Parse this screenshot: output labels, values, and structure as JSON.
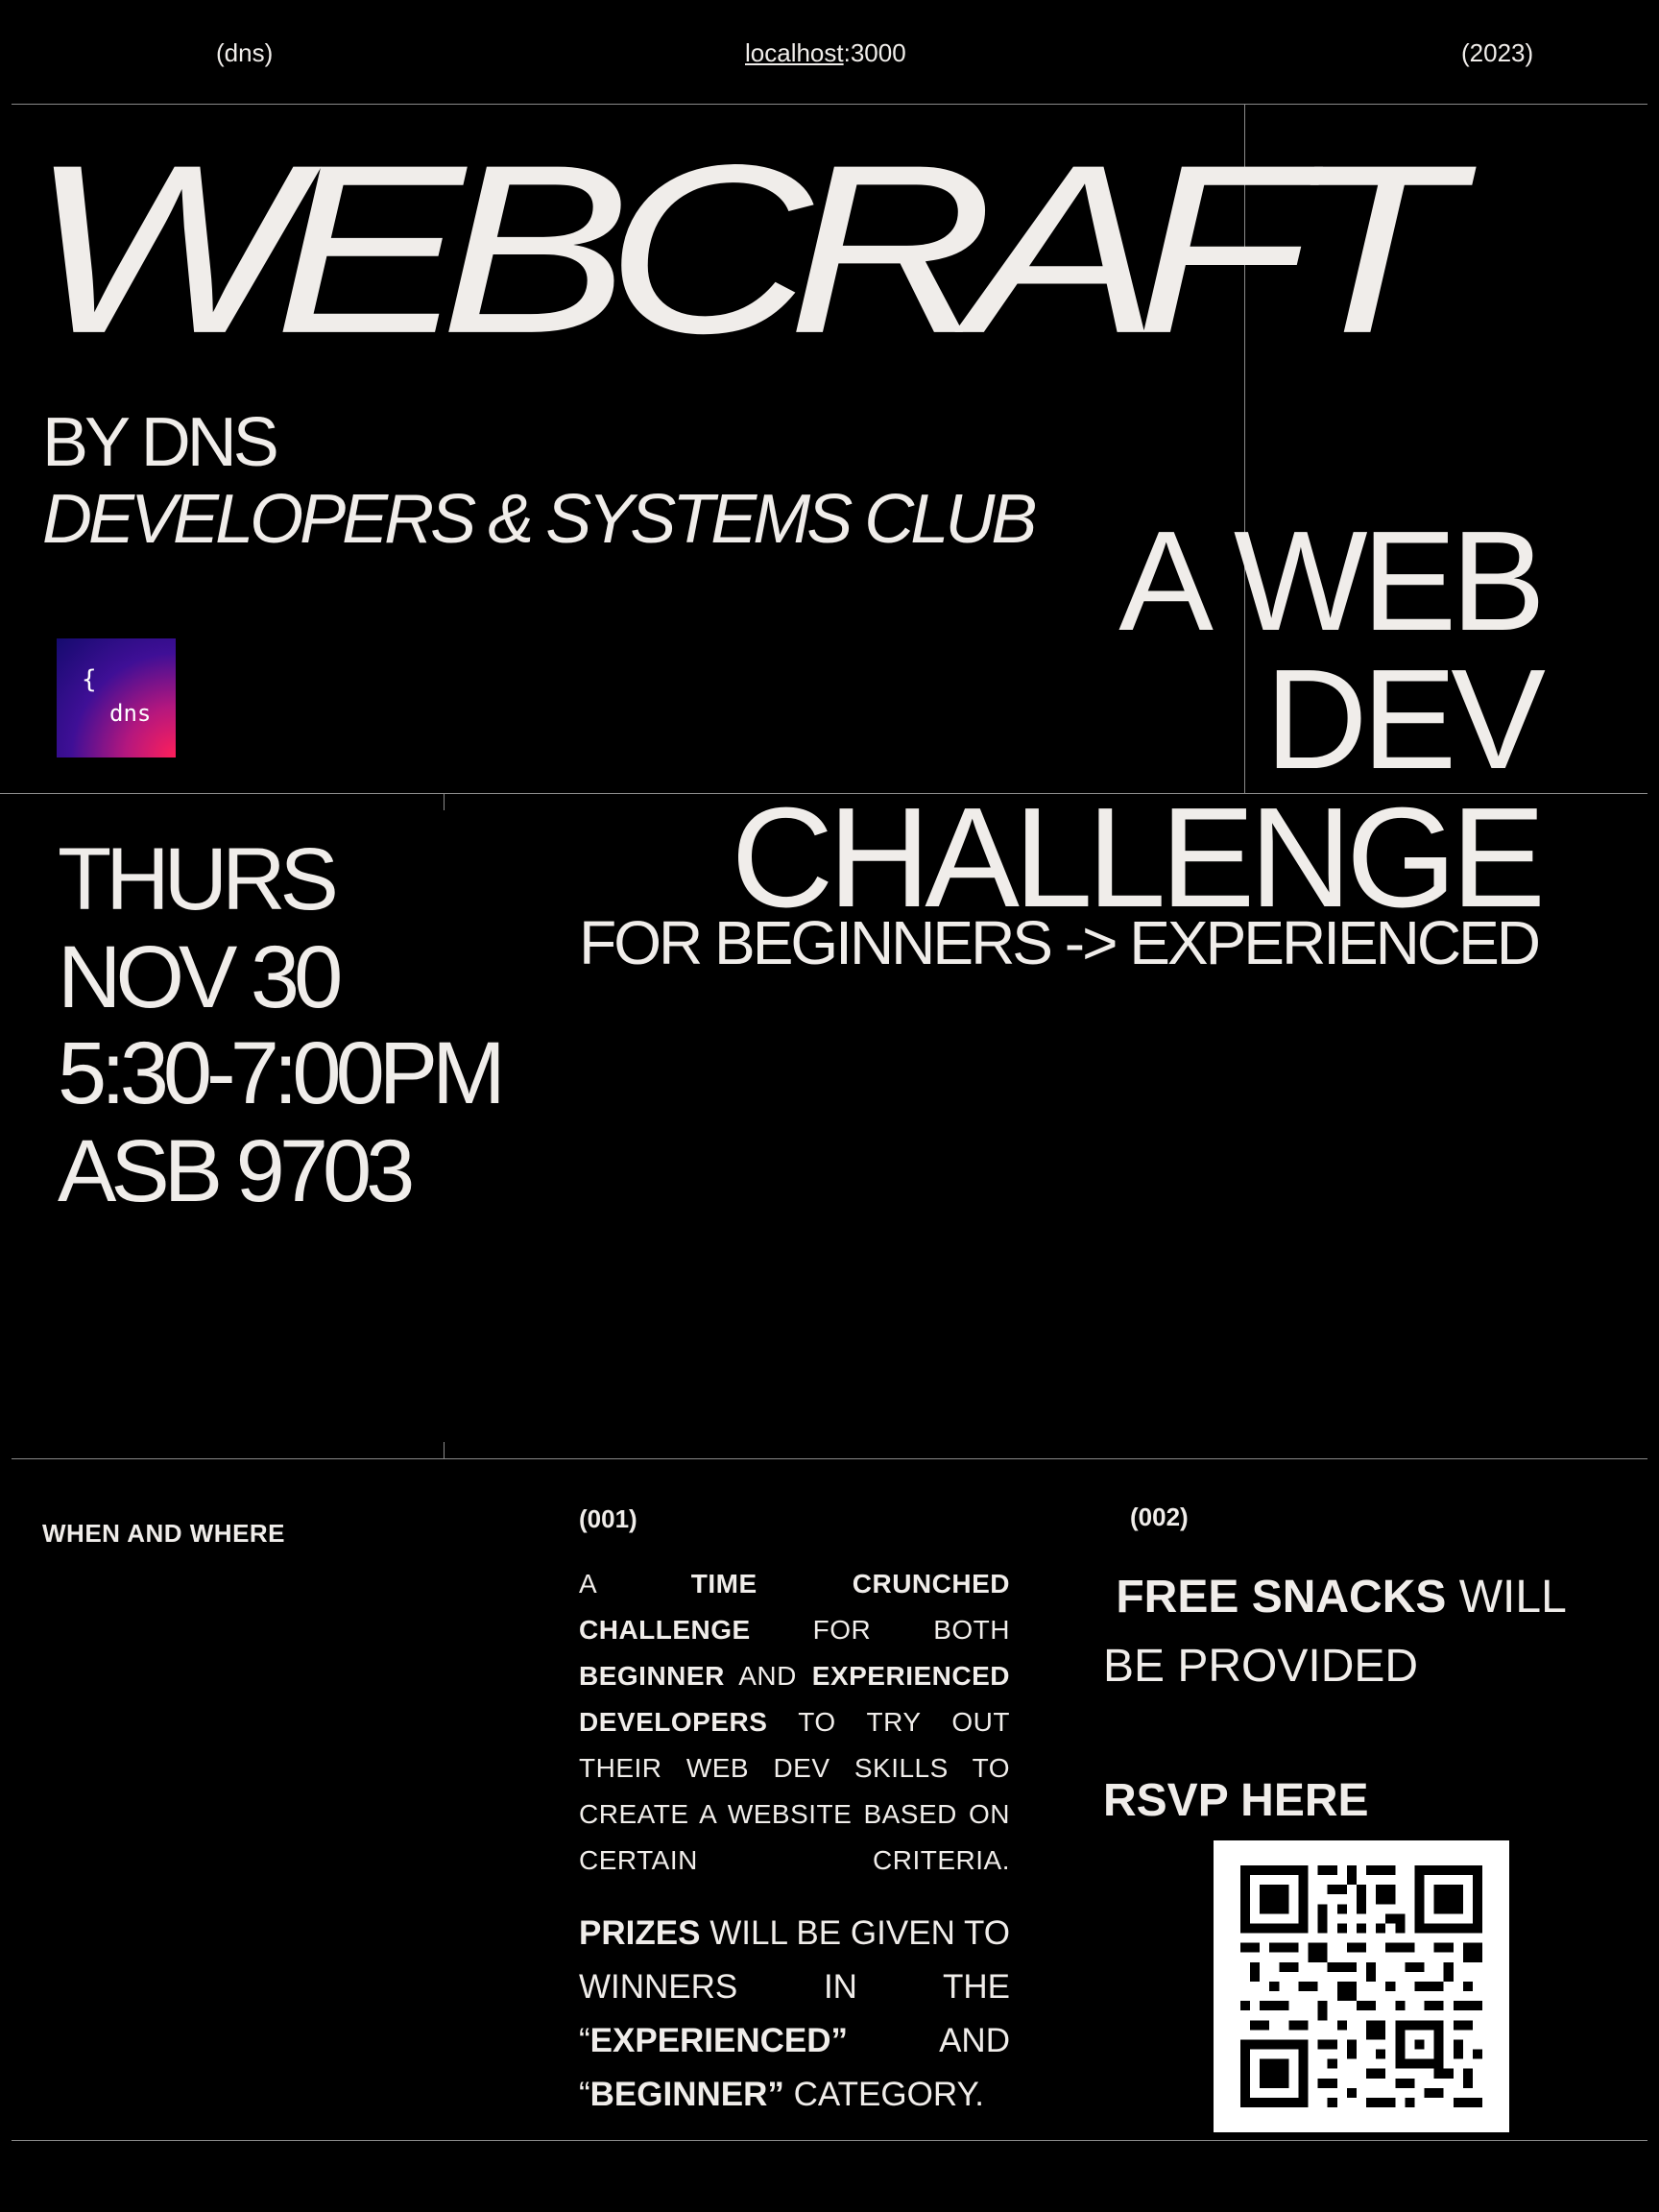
{
  "header": {
    "left": "(dns)",
    "center_host": "localhost",
    "center_port": ":3000",
    "right": "(2023)"
  },
  "hero": {
    "title": "WEBCRAFT",
    "by_line": "BY DNS",
    "club_name": "DEVELOPERS & SYSTEMS CLUB",
    "logo": {
      "brace": "{",
      "name": "dns"
    },
    "tagline_lines": [
      "A WEB",
      "DEV",
      "CHALLENGE"
    ],
    "subtitle": "FOR BEGINNERS -> EXPERIENCED"
  },
  "event": {
    "day": "THURS",
    "date": "NOV 30",
    "time": "5:30-7:00PM",
    "location": "ASB 9703"
  },
  "details": {
    "heading": "WHEN AND WHERE",
    "item1_num": "(001)",
    "item1_p1": [
      "A ",
      "TIME CRUNCHED CHALLENGE",
      " FOR BOTH ",
      "BEGINNER",
      " AND ",
      "EXPERIENCED DEVELOPERS",
      " TO TRY OUT THEIR WEB DEV SKILLS TO CREATE A WEBSITE BASED ON CERTAIN CRITERIA."
    ],
    "item1_p2": [
      "PRIZES",
      " WILL BE GIVEN TO WINNERS IN THE “",
      "EXPERIENCED”",
      " AND “",
      "BEGINNER”",
      " CATEGORY."
    ],
    "item2_num": "(002)",
    "snacks_bold": "FREE SNACKS",
    "snacks_rest": " WILL BE PROVIDED",
    "rsvp": "RSVP HERE"
  },
  "colors": {
    "background": "#000000",
    "text": "#f0edea",
    "rule": "#8a8a8a"
  },
  "icons": {
    "logo": "dns-logo-icon",
    "qr": "qr-code-icon"
  }
}
